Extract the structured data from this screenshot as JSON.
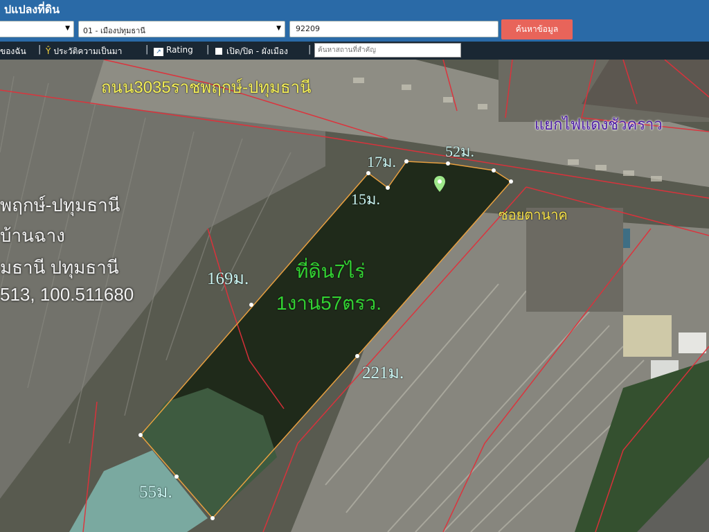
{
  "header": {
    "title": "ปแปลงที่ดิน"
  },
  "search": {
    "province_value": "",
    "district_value": "01 - เมืองปทุมธานี",
    "parcel_value": "92209",
    "button_label": "ค้นหาข้อมูล"
  },
  "toolbar": {
    "item_mine": "ของฉัน",
    "item_history": "ประวัติความเป็นมา",
    "item_rating": "Rating",
    "item_toggle": "เปิด/ปิด - ผังเมือง",
    "place_placeholder": "ค้นหาสถานที่สำคัญ",
    "sep": "|"
  },
  "map": {
    "road_main": "ถนน3035ราชพฤกษ์-ปทุมธานี",
    "junction": "แยกไฟแดงชัวคราว",
    "soi": "ซอยตานาค",
    "measurements": {
      "top_short": "17ม.",
      "top_right": "52ม.",
      "inner": "15ม.",
      "left_long": "169ม.",
      "right_long": "221ม.",
      "bottom": "55ม."
    },
    "parcel_area": {
      "line1": "ที่ดิน7ไร่",
      "line2": "1งาน57ตรว."
    },
    "address": {
      "line1": "พฤกษ์-ปทุมธานี",
      "line2": "บ้านฉาง",
      "line3": "มธานี ปทุมธานี",
      "line4": "513, 100.511680"
    },
    "colors": {
      "parcel_outline": "#e8a040",
      "cadastral_lines": "#e0303a",
      "area_text": "#33d233",
      "measure_text": "#c9f3f0"
    },
    "icons": {
      "marker": "map-pin-icon"
    }
  }
}
